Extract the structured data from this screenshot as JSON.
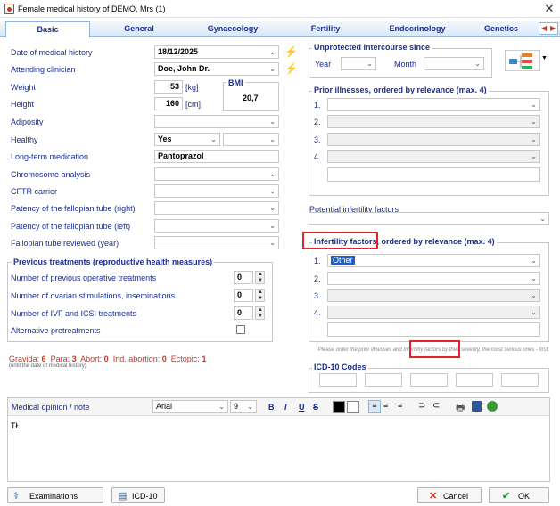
{
  "window": {
    "title": "Female medical history of DEMO, Mrs (1)"
  },
  "tabs": [
    {
      "label": "Basic",
      "active": true
    },
    {
      "label": "General"
    },
    {
      "label": "Gynaecology"
    },
    {
      "label": "Fertility"
    },
    {
      "label": "Endocrinology"
    },
    {
      "label": "Genetics"
    }
  ],
  "left": {
    "date_label": "Date of medical history",
    "date_value": "18/12/2025",
    "clinician_label": "Attending clinician",
    "clinician_value": "Doe, John Dr.",
    "weight_label": "Weight",
    "weight_value": "53",
    "weight_unit": "[kg]",
    "height_label": "Height",
    "height_value": "160",
    "height_unit": "[cm]",
    "bmi_label": "BMI",
    "bmi_value": "20,7",
    "adiposity_label": "Adiposity",
    "healthy_label": "Healthy",
    "healthy_value": "Yes",
    "medication_label": "Long-term medication",
    "medication_value": "Pantoprazol",
    "chromosome_label": "Chromosome analysis",
    "cftr_label": "CFTR carrier",
    "patency_right_label": "Patency of the fallopian tube (right)",
    "patency_left_label": "Patency of the fallopian tube (left)",
    "reviewed_label": "Fallopian tube reviewed (year)"
  },
  "treatments": {
    "title": "Previous treatments (reproductive health measures)",
    "operative_label": "Number of previous operative treatments",
    "operative_value": "0",
    "stimulations_label": "Number of ovarian stimulations, inseminations",
    "stimulations_value": "0",
    "ivf_label": "Number of IVF and ICSI treatments",
    "ivf_value": "0",
    "alternative_label": "Alternative pretreatments"
  },
  "obstetric": {
    "gravida_label": "Gravida:",
    "gravida_value": "6",
    "para_label": "Para:",
    "para_value": "3",
    "abort_label": "Abort:",
    "abort_value": "0",
    "ind_label": "Ind. abortion:",
    "ind_value": "0",
    "ectopic_label": "Ectopic:",
    "ectopic_value": "1",
    "note": "(until the date of medical history)"
  },
  "right": {
    "unprotected_title": "Unprotected intercourse since",
    "year_label": "Year",
    "month_label": "Month",
    "prior_title": "Prior illnesses, ordered by relevance (max. 4)",
    "potential_label": "Potential infertility factors",
    "infertility_title": "Infertility factors, ordered by relevance (max. 4)",
    "infertility_1": "Other",
    "order_note": "Please order the prior illnesses and infertility factors by their severity, the most serious ones - first.",
    "icd_title": "ICD-10 Codes",
    "row_numbers": [
      "1.",
      "2.",
      "3.",
      "4."
    ]
  },
  "editor": {
    "label": "Medical opinion / note",
    "font": "Arial",
    "size": "9",
    "content": "TŁ"
  },
  "buttons": {
    "examinations": "Examinations",
    "icd10": "ICD-10",
    "cancel": "Cancel",
    "ok": "OK"
  },
  "colors": {
    "label": "#1b2d8f",
    "accent_red": "#e0242b",
    "bolt": "#f0a000",
    "selection": "#1e5fc9"
  }
}
